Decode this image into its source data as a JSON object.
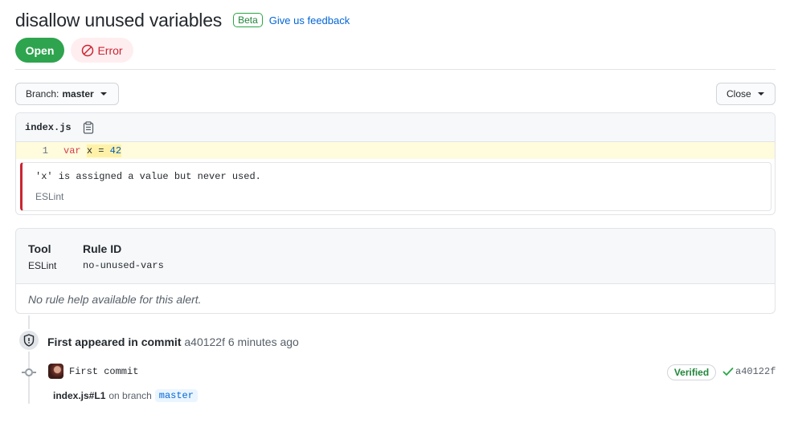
{
  "header": {
    "title": "disallow unused variables",
    "beta_label": "Beta",
    "feedback_link": "Give us feedback"
  },
  "state": {
    "open_label": "Open",
    "severity_label": "Error",
    "severity_icon": "circle-slash-icon"
  },
  "toolbar": {
    "branch_prefix": "Branch:",
    "branch_name": "master",
    "close_label": "Close"
  },
  "code": {
    "filename": "index.js",
    "copy_icon": "clipboard-icon",
    "line_number": "1",
    "keyword": "var",
    "highlight_pre": "x = ",
    "highlight_num": "42",
    "alert_message": "'x' is assigned a value but never used.",
    "alert_tool": "ESLint"
  },
  "rule": {
    "tool_header": "Tool",
    "tool_value": "ESLint",
    "rule_header": "Rule ID",
    "rule_value": "no-unused-vars",
    "help_text": "No rule help available for this alert."
  },
  "timeline": {
    "event_icon": "shield-icon",
    "event_label": "First appeared in commit",
    "event_sha": "a40122f",
    "event_time": "6 minutes ago",
    "commit_message": "First commit",
    "verified_label": "Verified",
    "commit_sha": "a40122f",
    "location_file": "index.js#L1",
    "location_on": "on branch",
    "location_branch": "master"
  },
  "colors": {
    "open_green": "#2ea44f",
    "error_red": "#cb2431",
    "link_blue": "#0366d6",
    "highlight_yellow": "#fff2a8"
  }
}
